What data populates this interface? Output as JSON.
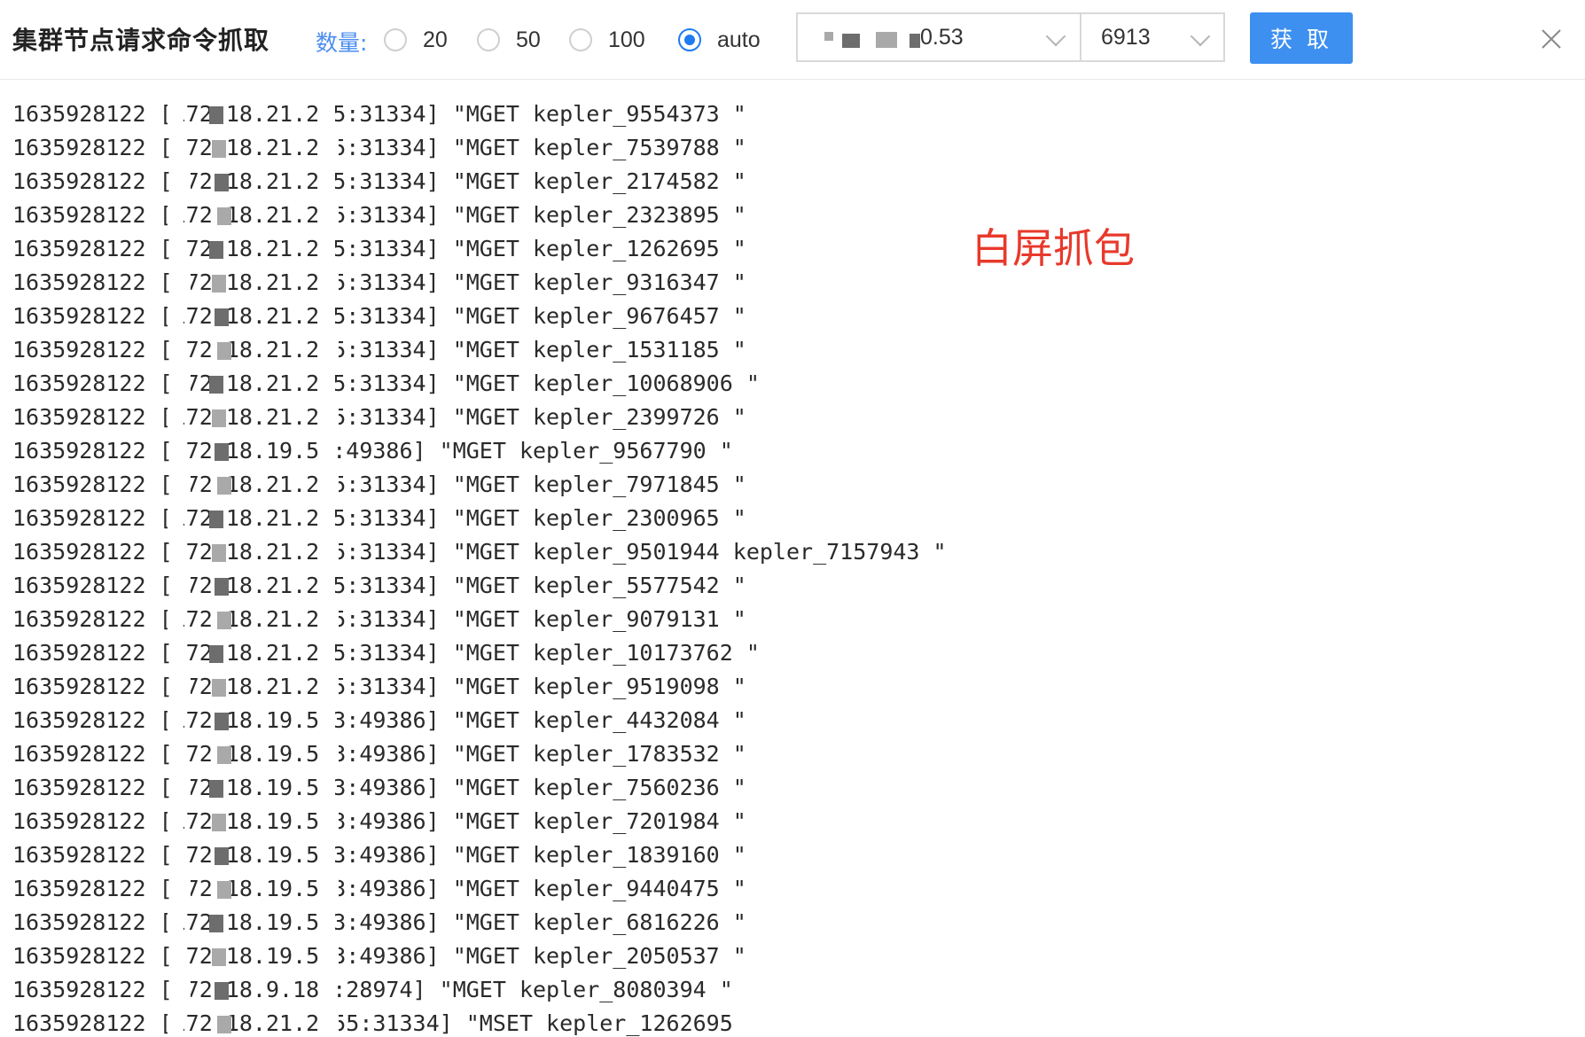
{
  "toolbar": {
    "title": "集群节点请求命令抓取",
    "quantity_label": "数量:",
    "options": [
      {
        "label": "20",
        "checked": false
      },
      {
        "label": "50",
        "checked": false
      },
      {
        "label": "100",
        "checked": false
      },
      {
        "label": "auto",
        "checked": true
      }
    ],
    "host_select_value": "0.53",
    "port_select_value": "6913",
    "fetch_label": "获 取",
    "close_label": "X"
  },
  "annotation": "白屏抓包",
  "log_lines": [
    "1635928122 [172.18.21.2 5:31334] \"MGET kepler_9554373 \"",
    "1635928122 [172.18.21.2 5:31334] \"MGET kepler_7539788 \"",
    "1635928122 [172.18.21.2 5:31334] \"MGET kepler_2174582 \"",
    "1635928122 [172.18.21.2 5:31334] \"MGET kepler_2323895 \"",
    "1635928122 [172.18.21.2 5:31334] \"MGET kepler_1262695 \"",
    "1635928122 [172.18.21.2 5:31334] \"MGET kepler_9316347 \"",
    "1635928122 [172.18.21.2 5:31334] \"MGET kepler_9676457 \"",
    "1635928122 [172.18.21.2 5:31334] \"MGET kepler_1531185 \"",
    "1635928122 [172.18.21.2 5:31334] \"MGET kepler_10068906 \"",
    "1635928122 [172.18.21.2 5:31334] \"MGET kepler_2399726 \"",
    "1635928122 [172.18.19.5 :49386] \"MGET kepler_9567790 \"",
    "1635928122 [172.18.21.2 5:31334] \"MGET kepler_7971845 \"",
    "1635928122 [172.18.21.2 5:31334] \"MGET kepler_2300965 \"",
    "1635928122 [172.18.21.2 5:31334] \"MGET kepler_9501944 kepler_7157943 \"",
    "1635928122 [172.18.21.2 5:31334] \"MGET kepler_5577542 \"",
    "1635928122 [172.18.21.2 5:31334] \"MGET kepler_9079131 \"",
    "1635928122 [172.18.21.2 5:31334] \"MGET kepler_10173762 \"",
    "1635928122 [172.18.21.2 5:31334] \"MGET kepler_9519098 \"",
    "1635928122 [172.18.19.5 3:49386] \"MGET kepler_4432084 \"",
    "1635928122 [172.18.19.5 3:49386] \"MGET kepler_1783532 \"",
    "1635928122 [172.18.19.5 3:49386] \"MGET kepler_7560236 \"",
    "1635928122 [172.18.19.5 3:49386] \"MGET kepler_7201984 \"",
    "1635928122 [172.18.19.5 3:49386] \"MGET kepler_1839160 \"",
    "1635928122 [172.18.19.5 3:49386] \"MGET kepler_9440475 \"",
    "1635928122 [172.18.19.5 3:49386] \"MGET kepler_6816226 \"",
    "1635928122 [172.18.19.5 3:49386] \"MGET kepler_2050537 \"",
    "1635928122 [172.18.9.18 :28974] \"MGET kepler_8080394 \"",
    "1635928122 [172.18.21.2 55:31334] \"MSET kepler_1262695"
  ]
}
